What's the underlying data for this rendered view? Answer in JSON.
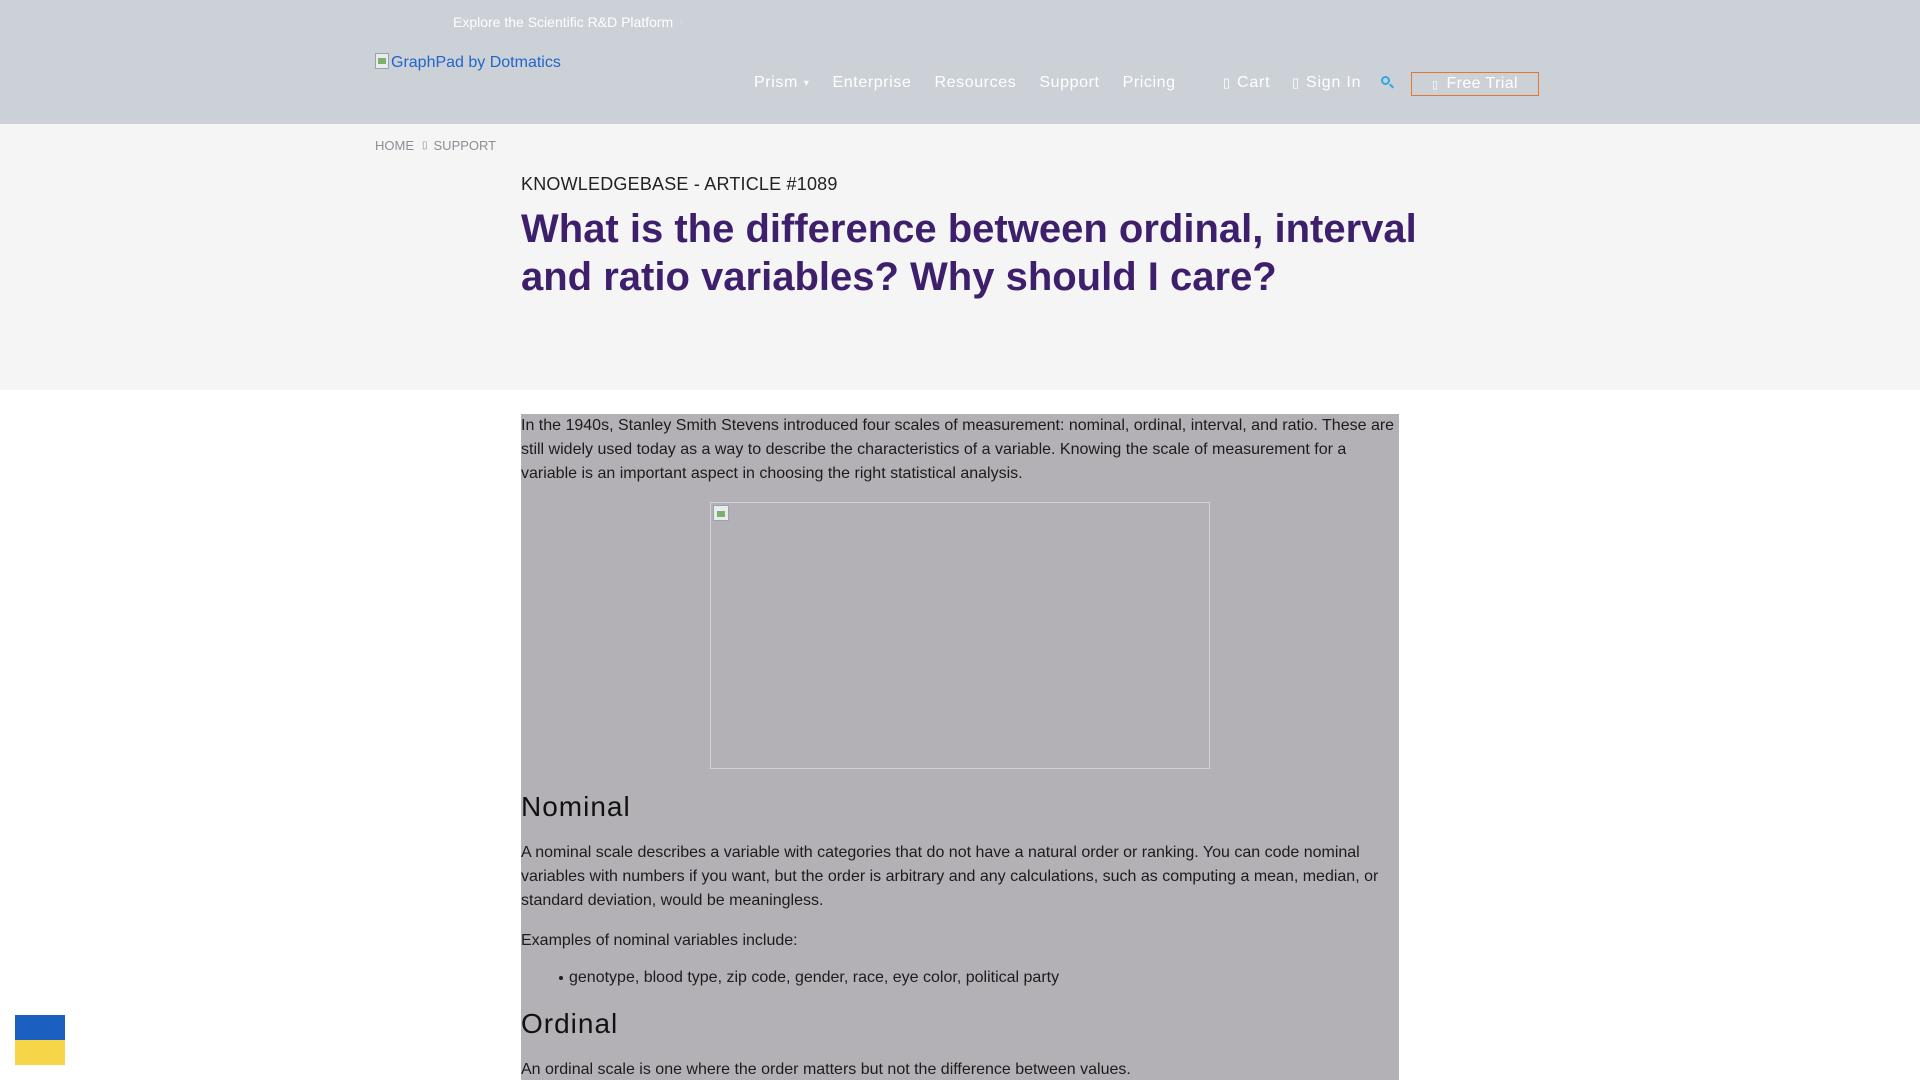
{
  "topbar": {
    "link_text": "Explore the Scientific R&D Platform",
    "arrow_icon": "chevron-right-icon"
  },
  "header": {
    "logo_alt": "GraphPad by Dotmatics",
    "nav": [
      {
        "label": "Prism",
        "has_caret": true
      },
      {
        "label": "Enterprise"
      },
      {
        "label": "Resources"
      },
      {
        "label": "Support"
      },
      {
        "label": "Pricing"
      }
    ],
    "cart_label": "Cart",
    "signin_label": "Sign In",
    "free_trial_label": "Free Trial"
  },
  "breadcrumb": {
    "home": "HOME",
    "support": "SUPPORT"
  },
  "hero": {
    "kb_label": "KNOWLEDGEBASE - ARTICLE #1089",
    "title": "What is the difference between ordinal, interval and ratio variables? Why should I care?"
  },
  "article": {
    "intro": "In the 1940s, Stanley Smith Stevens introduced four scales of measurement: nominal, ordinal, interval, and ratio. These are still widely used today as a way to describe the characteristics of a variable. Knowing the scale of measurement for a variable is an important aspect in choosing the right statistical analysis.",
    "nominal_heading": "Nominal",
    "nominal_text": "A nominal scale describes a variable with categories that do not have a natural order or ranking. You can code nominal variables with numbers if you want, but the order is arbitrary and any calculations, such as computing a mean, median, or standard deviation, would be meaningless.",
    "nominal_examples_intro": "Examples of nominal variables include:",
    "nominal_examples": [
      "genotype, blood type, zip code, gender, race, eye color, political party"
    ],
    "ordinal_heading": "Ordinal",
    "ordinal_text": "An ordinal scale is one where the order matters but not the difference between values."
  },
  "colors": {
    "title": "#3e1f6b",
    "accent_orange": "#e0782f",
    "search_blue": "#2fa8e0",
    "flag_blue": "#1b5fc0",
    "flag_yellow": "#f7d548"
  }
}
